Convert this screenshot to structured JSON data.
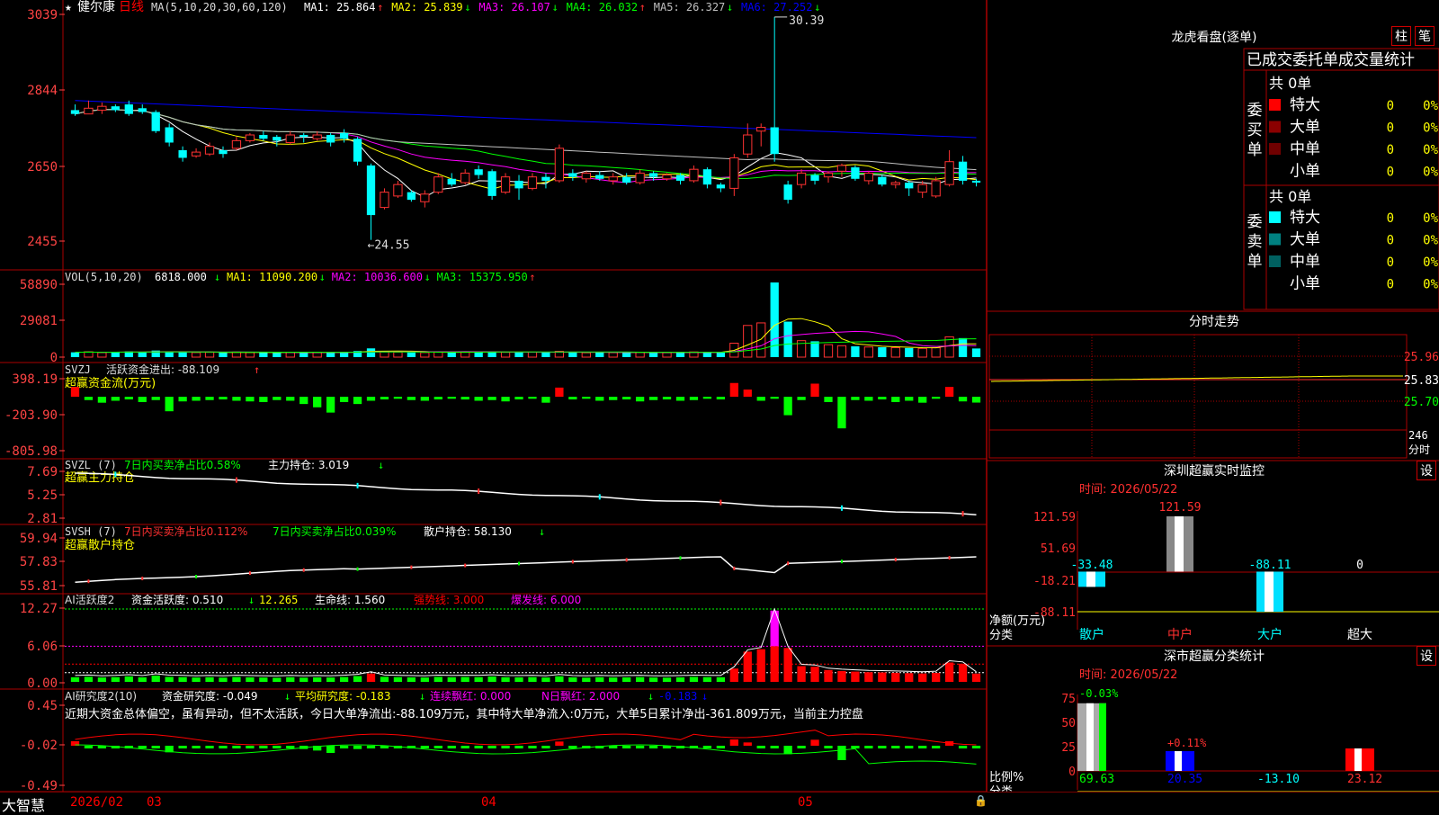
{
  "stock": {
    "star": "★",
    "name": "健尔康",
    "period": "日线"
  },
  "main_chart": {
    "y_ticks": [
      "3039",
      "2844",
      "2650",
      "2455"
    ],
    "ma_header": "MA(5,10,20,30,60,120)",
    "ma": [
      {
        "label": "MA1:",
        "value": "25.864",
        "arrow": "↑",
        "color": "#ffffff"
      },
      {
        "label": "MA2:",
        "value": "25.839",
        "arrow": "↓",
        "color": "#ffff00"
      },
      {
        "label": "MA3:",
        "value": "26.107",
        "arrow": "↓",
        "color": "#ff00ff"
      },
      {
        "label": "MA4:",
        "value": "26.032",
        "arrow": "↑",
        "color": "#00ff00"
      },
      {
        "label": "MA5:",
        "value": "26.327",
        "arrow": "↓",
        "color": "#c0c0c0"
      },
      {
        "label": "MA6:",
        "value": "27.252",
        "arrow": "↓",
        "color": "#0000ff"
      }
    ],
    "high_label": "30.39",
    "low_label": "←24.55"
  },
  "vol_chart": {
    "y_ticks": [
      "58890",
      "29081",
      "0"
    ],
    "header": "VOL(5,10,20)",
    "value": "6818.000",
    "ma": [
      {
        "label": "MA1:",
        "value": "11090.200",
        "arrow": "↓",
        "color": "#ffff00"
      },
      {
        "label": "MA2:",
        "value": "10036.600",
        "arrow": "↓",
        "color": "#ff00ff"
      },
      {
        "label": "MA3:",
        "value": "15375.950",
        "arrow": "↑",
        "color": "#00ff00"
      }
    ]
  },
  "svzj": {
    "y_ticks": [
      "398.19",
      "-203.90",
      "-805.98"
    ],
    "header": "SVZJ",
    "label": "活跃资金进出:",
    "value": "-88.109",
    "arrow": "↑",
    "sub": "超赢资金流(万元)"
  },
  "svzl": {
    "y_ticks": [
      "7.69",
      "5.25",
      "2.81"
    ],
    "header": "SVZL (7)",
    "l1": "7日内买卖净占比0.58%",
    "l2": "主力持仓:",
    "value": "3.019",
    "arrow": "↓",
    "sub": "超赢主力持仓"
  },
  "svsh": {
    "y_ticks": [
      "59.94",
      "57.83",
      "55.81"
    ],
    "header": "SVSH (7)",
    "l1": "7日内买卖净占比0.112%",
    "l2": "7日内买卖净占比0.039%",
    "l3": "散户持仓:",
    "value": "58.130",
    "arrow": "↓",
    "sub": "超赢散户持仓"
  },
  "ai_active": {
    "y_ticks": [
      "12.27",
      "6.06",
      "0.00"
    ],
    "header": "AI活跃度2",
    "l1": "资金活跃度:",
    "v1": "0.510",
    "arrow1": "↓",
    "v2": "12.265",
    "l3": "生命线:",
    "v3": "1.560",
    "l4": "强势线:",
    "v4": "3.000",
    "l5": "爆发线:",
    "v5": "6.000"
  },
  "ai_research": {
    "y_ticks": [
      "0.45",
      "-0.02",
      "-0.49"
    ],
    "header": "AI研究度2(10)",
    "l1": "资金研究度:",
    "v1": "-0.049",
    "arrow1": "↓",
    "l2": "平均研究度:",
    "v2": "-0.183",
    "arrow2": "↓",
    "l3": "连续飘红:",
    "v3": "0.000",
    "l4": "N日飘红:",
    "v4": "2.000",
    "arrow4": "↓",
    "v5": "-0.183",
    "arrow5": "↓",
    "comment": "近期大资金总体偏空，虽有异动，但不太活跃，今日大单净流出:-88.109万元，其中特大单净流入:0万元，大单5日累计净出-361.809万元，当前主力控盘"
  },
  "x_axis": {
    "brand": "大智慧",
    "labels": [
      "2026/02",
      "03",
      "04",
      "05"
    ]
  },
  "right": {
    "longhu_title": "龙虎看盘(逐单)",
    "btn_zhu": "柱",
    "btn_bi": "笔",
    "table_title": "已成交委托单成交量统计",
    "buy_side": "委买单",
    "sell_side": "委卖单",
    "buy_total": "共 0单",
    "sell_total": "共 0单",
    "buy_rows": [
      {
        "label": "特大",
        "count": "0",
        "pct": "0%",
        "color": "#ff0000"
      },
      {
        "label": "大单",
        "count": "0",
        "pct": "0%",
        "color": "#8b0000"
      },
      {
        "label": "中单",
        "count": "0",
        "pct": "0%",
        "color": "#700000"
      },
      {
        "label": "小单",
        "count": "0",
        "pct": "0%",
        "color": ""
      }
    ],
    "sell_rows": [
      {
        "label": "特大",
        "count": "0",
        "pct": "0%",
        "color": "#00ffff"
      },
      {
        "label": "大单",
        "count": "0",
        "pct": "0%",
        "color": "#008080"
      },
      {
        "label": "中单",
        "count": "0",
        "pct": "0%",
        "color": "#006060"
      },
      {
        "label": "小单",
        "count": "0",
        "pct": "0%",
        "color": ""
      }
    ],
    "intraday_title": "分时走势",
    "intraday_ticks": [
      "25.96",
      "25.83",
      "25.70"
    ],
    "intraday_vol_tick": "246",
    "intraday_vol_unit": "分时",
    "sz_title": "深圳超赢实时监控",
    "sz_btn": "设",
    "sz_time": "时间: 2026/05/22",
    "sz_ticks": [
      "121.59",
      "51.69",
      "-18.21",
      "-88.11"
    ],
    "sz_net_label": "净额(万元)",
    "sz_class_label": "分类",
    "sz_cats": [
      "散户",
      "中户",
      "大户",
      "超大"
    ],
    "sz_values": [
      -33.48,
      121.59,
      -88.11,
      0
    ],
    "sz_value_labels": [
      "-33.48",
      "121.59",
      "-88.11",
      "0"
    ],
    "ss_title": "深市超赢分类统计",
    "ss_btn": "设",
    "ss_time": "时间: 2026/05/22",
    "ss_ticks": [
      "75",
      "50",
      "25",
      "0"
    ],
    "ss_ratio_label": "比例%",
    "ss_class_label": "分类",
    "ss_cats": [
      "散户",
      "中户",
      "大户",
      "超大"
    ],
    "ss_values": [
      69.63,
      20.35,
      -13.1,
      23.12
    ],
    "ss_value_labels": [
      "69.63",
      "20.35",
      "-13.10",
      "23.12"
    ],
    "ss_top_labels": [
      "-0.03%",
      "+0.11%"
    ]
  },
  "chart_data": {
    "type": "candlestick",
    "title": "健尔康 日线",
    "x_labels": [
      "2026/02",
      "03",
      "04",
      "05"
    ],
    "price_ylim": [
      24.0,
      30.6
    ],
    "candles": [
      [
        27.95,
        27.85,
        28.1,
        27.8
      ],
      [
        27.85,
        28.0,
        28.2,
        27.85
      ],
      [
        27.95,
        28.05,
        28.15,
        27.85
      ],
      [
        28.05,
        27.95,
        28.1,
        27.9
      ],
      [
        28.1,
        27.85,
        28.2,
        27.8
      ],
      [
        28.0,
        27.9,
        28.1,
        27.85
      ],
      [
        27.9,
        27.4,
        27.95,
        27.35
      ],
      [
        27.5,
        27.1,
        27.6,
        27.0
      ],
      [
        26.9,
        26.7,
        27.0,
        26.6
      ],
      [
        26.75,
        26.85,
        26.95,
        26.7
      ],
      [
        26.8,
        27.0,
        27.1,
        26.75
      ],
      [
        26.9,
        26.8,
        27.0,
        26.7
      ],
      [
        26.95,
        27.15,
        27.25,
        26.9
      ],
      [
        27.15,
        27.3,
        27.35,
        27.1
      ],
      [
        27.3,
        27.2,
        27.4,
        27.15
      ],
      [
        27.25,
        27.15,
        27.3,
        27.0
      ],
      [
        27.1,
        27.3,
        27.4,
        27.05
      ],
      [
        27.3,
        27.25,
        27.35,
        27.1
      ],
      [
        27.2,
        27.3,
        27.4,
        27.15
      ],
      [
        27.3,
        27.1,
        27.35,
        27.0
      ],
      [
        27.35,
        27.2,
        27.45,
        27.1
      ],
      [
        27.2,
        26.6,
        27.25,
        26.5
      ],
      [
        26.5,
        25.2,
        26.55,
        24.55
      ],
      [
        25.4,
        25.8,
        25.9,
        25.35
      ],
      [
        25.7,
        26.0,
        26.1,
        25.65
      ],
      [
        25.8,
        25.6,
        25.85,
        25.55
      ],
      [
        25.55,
        25.75,
        25.85,
        25.4
      ],
      [
        25.8,
        26.2,
        26.3,
        25.75
      ],
      [
        26.15,
        26.0,
        26.3,
        25.95
      ],
      [
        26.05,
        26.3,
        26.4,
        26.0
      ],
      [
        26.4,
        26.25,
        26.5,
        26.15
      ],
      [
        26.35,
        25.7,
        26.4,
        25.6
      ],
      [
        25.8,
        26.2,
        26.3,
        25.75
      ],
      [
        26.1,
        25.9,
        26.25,
        25.6
      ],
      [
        25.9,
        26.2,
        26.3,
        25.85
      ],
      [
        26.2,
        26.1,
        26.3,
        25.9
      ],
      [
        26.1,
        26.95,
        27.05,
        26.05
      ],
      [
        26.3,
        26.2,
        26.4,
        26.1
      ],
      [
        26.15,
        26.3,
        26.35,
        26.05
      ],
      [
        26.25,
        26.15,
        26.35,
        26.1
      ],
      [
        26.1,
        26.2,
        26.3,
        26.0
      ],
      [
        26.2,
        26.05,
        26.3,
        26.0
      ],
      [
        26.05,
        26.3,
        26.4,
        26.0
      ],
      [
        26.3,
        26.2,
        26.35,
        26.1
      ],
      [
        26.15,
        26.25,
        26.3,
        26.1
      ],
      [
        26.25,
        26.1,
        26.3,
        26.0
      ],
      [
        26.1,
        26.4,
        26.5,
        26.05
      ],
      [
        26.4,
        26.0,
        26.45,
        25.9
      ],
      [
        26.0,
        25.9,
        26.05,
        25.8
      ],
      [
        25.9,
        26.7,
        26.8,
        25.7
      ],
      [
        26.8,
        27.3,
        27.6,
        26.7
      ],
      [
        27.4,
        27.5,
        27.6,
        27.0
      ],
      [
        27.5,
        26.8,
        30.39,
        26.6
      ],
      [
        26.0,
        25.6,
        26.1,
        25.5
      ],
      [
        26.0,
        26.3,
        26.4,
        25.9
      ],
      [
        26.25,
        26.1,
        26.3,
        26.0
      ],
      [
        26.2,
        26.3,
        26.35,
        26.05
      ],
      [
        26.35,
        26.5,
        26.55,
        26.2
      ],
      [
        26.45,
        26.15,
        26.5,
        26.1
      ],
      [
        26.1,
        26.3,
        26.35,
        26.0
      ],
      [
        26.2,
        26.0,
        26.25,
        25.95
      ],
      [
        26.0,
        26.05,
        26.1,
        25.9
      ],
      [
        26.05,
        25.9,
        26.1,
        25.7
      ],
      [
        25.8,
        26.0,
        26.1,
        25.65
      ],
      [
        25.7,
        26.1,
        26.2,
        25.65
      ],
      [
        26.0,
        26.6,
        26.9,
        25.95
      ],
      [
        26.6,
        26.1,
        26.75,
        26.0
      ],
      [
        26.1,
        26.05,
        26.15,
        25.95
      ]
    ],
    "volume_ylim": [
      0,
      58890
    ],
    "volume": [
      3800,
      4200,
      3600,
      3900,
      4500,
      3700,
      5200,
      4100,
      3900,
      3600,
      3800,
      3500,
      4000,
      3700,
      3600,
      3400,
      3800,
      3500,
      3700,
      3600,
      4000,
      4800,
      6900,
      4200,
      3900,
      3700,
      3600,
      4100,
      3800,
      4000,
      3900,
      4400,
      3800,
      3700,
      3900,
      3600,
      4600,
      3700,
      3500,
      3800,
      3600,
      3700,
      3900,
      3600,
      3500,
      3700,
      4100,
      3900,
      3800,
      11000,
      25000,
      27000,
      58890,
      28000,
      13000,
      12500,
      9800,
      9000,
      8500,
      8000,
      7800,
      7500,
      7200,
      6900,
      7400,
      16000,
      15000,
      6818
    ],
    "svzj_ylim": [
      -805.98,
      398.19
    ],
    "svzj": [
      150,
      -50,
      -90,
      -60,
      -40,
      -80,
      -50,
      -220,
      -70,
      -60,
      -50,
      -40,
      -60,
      -70,
      -80,
      -50,
      -60,
      -110,
      -160,
      -240,
      -80,
      -110,
      -60,
      -40,
      -30,
      -50,
      -60,
      -40,
      -30,
      -20,
      -60,
      -50,
      -70,
      -40,
      -30,
      -90,
      140,
      -40,
      -30,
      -60,
      -50,
      -40,
      -70,
      -50,
      -40,
      -60,
      -50,
      -30,
      -40,
      210,
      110,
      -60,
      -30,
      -280,
      -50,
      200,
      -80,
      -480,
      -50,
      -60,
      -40,
      -80,
      -60,
      -90,
      -30,
      150,
      -70,
      -88.1
    ],
    "svzl_ylim": [
      2.81,
      7.69
    ],
    "svsh_ylim": [
      55.81,
      59.94
    ],
    "ai_active_ylim": [
      0,
      12.27
    ],
    "ai_research_ylim": [
      -0.49,
      0.45
    ],
    "right_intraday_ylim": [
      25.7,
      25.96
    ]
  }
}
